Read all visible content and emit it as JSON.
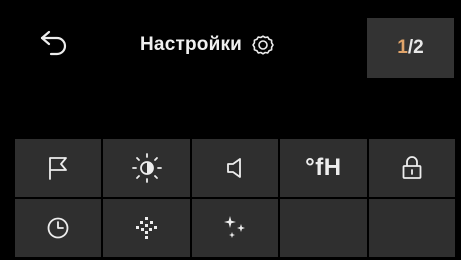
{
  "header": {
    "title": "Настройки",
    "page_current": "1",
    "page_separator": "/",
    "page_total": "2"
  },
  "icons": {
    "back": "back-arrow-icon",
    "settings": "gear-icon"
  },
  "grid": {
    "items": [
      {
        "name": "flag-icon",
        "label": ""
      },
      {
        "name": "brightness-icon",
        "label": ""
      },
      {
        "name": "volume-icon",
        "label": ""
      },
      {
        "name": "water-hardness-unit",
        "label": "°fH"
      },
      {
        "name": "lock-icon",
        "label": ""
      },
      {
        "name": "clock-icon",
        "label": ""
      },
      {
        "name": "sparkle-dots-icon",
        "label": ""
      },
      {
        "name": "sparkles-icon",
        "label": ""
      },
      {
        "name": "empty",
        "label": ""
      },
      {
        "name": "empty",
        "label": ""
      }
    ]
  },
  "colors": {
    "background": "#000000",
    "tile": "#2f2f2f",
    "page_indicator_bg": "#333333",
    "accent": "#e0a46a",
    "text": "#ededed"
  }
}
